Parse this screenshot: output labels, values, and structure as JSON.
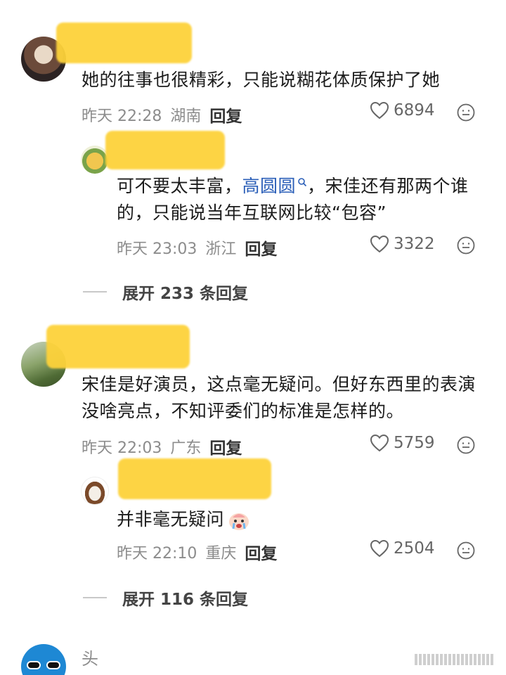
{
  "comments": [
    {
      "text": "她的往事也很精彩，只能说糊花体质保护了她",
      "time": "昨天 22:28",
      "location": "湖南",
      "reply_label": "回复",
      "likes": "6894",
      "replies": [
        {
          "text_before": "可不要太丰富，",
          "mention": "高圆圆",
          "text_after": "，宋佳还有那两个谁的，只能说当年互联网比较“包容”",
          "time": "昨天 23:03",
          "location": "浙江",
          "reply_label": "回复",
          "likes": "3322"
        }
      ],
      "expand_label": "展开 233 条回复"
    },
    {
      "text": "宋佳是好演员，这点毫无疑问。但好东西里的表演没啥亮点，不知评委们的标准是怎样的。",
      "time": "昨天 22:03",
      "location": "广东",
      "reply_label": "回复",
      "likes": "5759",
      "replies": [
        {
          "text": "并非毫无疑问",
          "time": "昨天 22:10",
          "location": "重庆",
          "reply_label": "回复",
          "likes": "2504"
        }
      ],
      "expand_label": "展开 116 条回复"
    },
    {
      "partial_name": "头"
    }
  ],
  "icons": {
    "like": "heart-outline-icon",
    "emoji": "smile-face-icon",
    "mention": "search-mention-icon",
    "cry_emoji": "crying-emoji-icon"
  },
  "colors": {
    "redaction": "#fdd23a",
    "mention": "#2b5fb8",
    "meta_gray": "#8c8c8c"
  }
}
